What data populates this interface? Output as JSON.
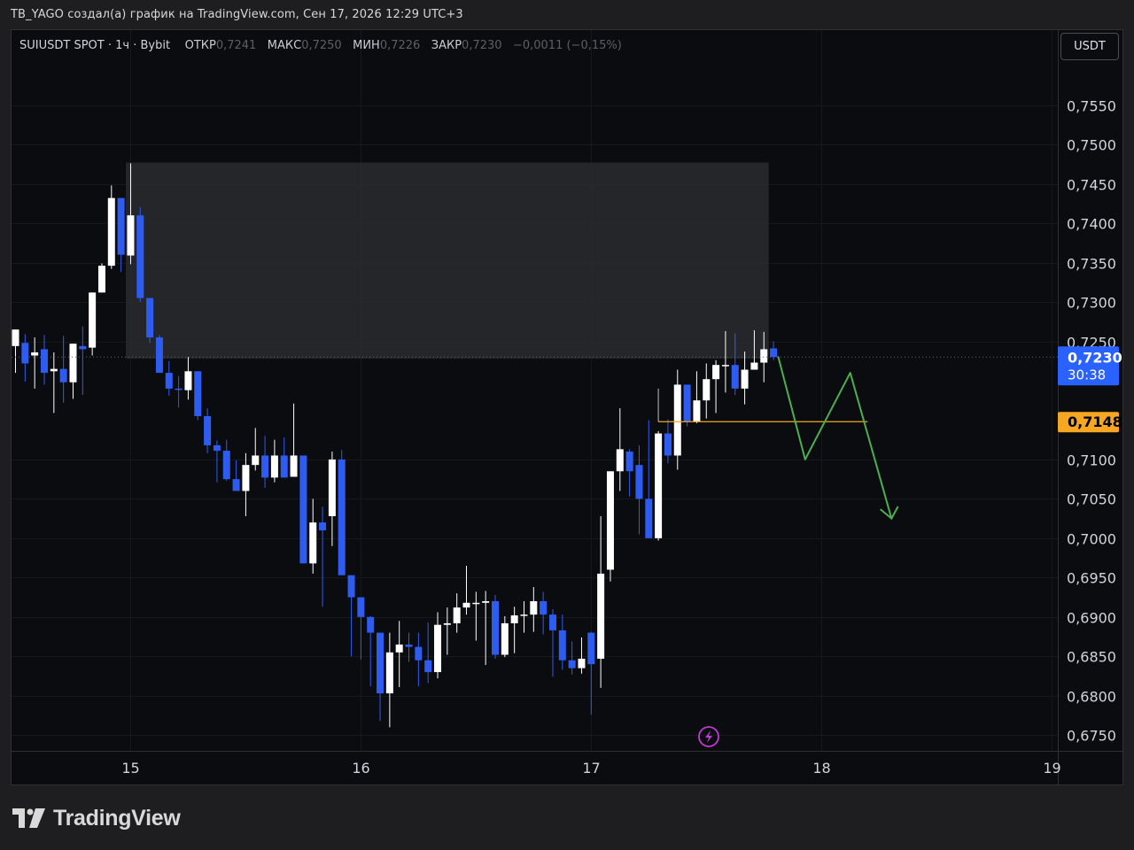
{
  "credit": "TB_YAGO создал(а) график на TradingView.com, Сен 17, 2026 12:29 UTC+3",
  "legend": {
    "symbol": "SUIUSDT SPOT · 1ч · Bybit",
    "open_label": "ОТКР",
    "open_value": "0,7241",
    "high_label": "МАКС",
    "high_value": "0,7250",
    "low_label": "МИН",
    "low_value": "0,7226",
    "close_label": "ЗАКР",
    "close_value": "0,7230",
    "change": "−0,0011 (−0,15%)"
  },
  "currency_button": "USDT",
  "logo_text": "TradingView",
  "colors": {
    "background": "#0b0c10",
    "bull": "#ffffff",
    "bear": "#2f5cf0",
    "zone": "#2a2b2f",
    "level": "#f5a623",
    "projection": "#4caf50",
    "price_tag": "#2962ff",
    "alert_icon": "#c03ad6"
  },
  "price_tag": {
    "price": "0,7230",
    "countdown": "30:38"
  },
  "level_tag": {
    "price": "0,7148"
  },
  "chart_data": {
    "type": "candlestick",
    "interval": "1h",
    "ylim": [
      0.673,
      0.7598
    ],
    "y_ticks": [
      {
        "value": 0.755,
        "label": "0,7550"
      },
      {
        "value": 0.75,
        "label": "0,7500"
      },
      {
        "value": 0.745,
        "label": "0,7450"
      },
      {
        "value": 0.74,
        "label": "0,7400"
      },
      {
        "value": 0.735,
        "label": "0,7350"
      },
      {
        "value": 0.73,
        "label": "0,7300"
      },
      {
        "value": 0.725,
        "label": "0,7250"
      },
      {
        "value": 0.71,
        "label": "0,7100"
      },
      {
        "value": 0.705,
        "label": "0,7050"
      },
      {
        "value": 0.7,
        "label": "0,7000"
      },
      {
        "value": 0.695,
        "label": "0,6950"
      },
      {
        "value": 0.69,
        "label": "0,6900"
      },
      {
        "value": 0.685,
        "label": "0,6850"
      },
      {
        "value": 0.68,
        "label": "0,6800"
      },
      {
        "value": 0.675,
        "label": "0,6750"
      }
    ],
    "x_ticks": [
      {
        "bar": 12,
        "label": "15"
      },
      {
        "bar": 36,
        "label": "16"
      },
      {
        "bar": 60,
        "label": "17"
      },
      {
        "bar": 84,
        "label": "18"
      },
      {
        "bar": 108,
        "label": "19"
      }
    ],
    "candles": [
      {
        "o": 0.7244,
        "h": 0.7263,
        "l": 0.721,
        "c": 0.7265
      },
      {
        "o": 0.7248,
        "h": 0.7259,
        "l": 0.7199,
        "c": 0.7222
      },
      {
        "o": 0.7232,
        "h": 0.7255,
        "l": 0.719,
        "c": 0.7236
      },
      {
        "o": 0.724,
        "h": 0.7258,
        "l": 0.7195,
        "c": 0.721
      },
      {
        "o": 0.7212,
        "h": 0.7236,
        "l": 0.7159,
        "c": 0.7215
      },
      {
        "o": 0.7215,
        "h": 0.7257,
        "l": 0.7172,
        "c": 0.7198
      },
      {
        "o": 0.7198,
        "h": 0.7239,
        "l": 0.7177,
        "c": 0.7247
      },
      {
        "o": 0.7244,
        "h": 0.7269,
        "l": 0.7182,
        "c": 0.724
      },
      {
        "o": 0.7242,
        "h": 0.7282,
        "l": 0.7232,
        "c": 0.7312
      },
      {
        "o": 0.7312,
        "h": 0.7349,
        "l": 0.7312,
        "c": 0.7346
      },
      {
        "o": 0.7346,
        "h": 0.7448,
        "l": 0.7342,
        "c": 0.7432
      },
      {
        "o": 0.7432,
        "h": 0.7432,
        "l": 0.7338,
        "c": 0.736
      },
      {
        "o": 0.7359,
        "h": 0.7476,
        "l": 0.7348,
        "c": 0.741
      },
      {
        "o": 0.741,
        "h": 0.742,
        "l": 0.73,
        "c": 0.7305
      },
      {
        "o": 0.7305,
        "h": 0.73,
        "l": 0.7248,
        "c": 0.7255
      },
      {
        "o": 0.7255,
        "h": 0.7258,
        "l": 0.721,
        "c": 0.721
      },
      {
        "o": 0.721,
        "h": 0.7225,
        "l": 0.7181,
        "c": 0.719
      },
      {
        "o": 0.719,
        "h": 0.7206,
        "l": 0.7166,
        "c": 0.7189
      },
      {
        "o": 0.7188,
        "h": 0.723,
        "l": 0.7176,
        "c": 0.7212
      },
      {
        "o": 0.7212,
        "h": 0.7208,
        "l": 0.715,
        "c": 0.7155
      },
      {
        "o": 0.7155,
        "h": 0.7165,
        "l": 0.7108,
        "c": 0.7118
      },
      {
        "o": 0.7118,
        "h": 0.7124,
        "l": 0.7071,
        "c": 0.7111
      },
      {
        "o": 0.7111,
        "h": 0.7125,
        "l": 0.7073,
        "c": 0.7075
      },
      {
        "o": 0.7075,
        "h": 0.7099,
        "l": 0.7066,
        "c": 0.706
      },
      {
        "o": 0.706,
        "h": 0.7108,
        "l": 0.7028,
        "c": 0.7093
      },
      {
        "o": 0.7093,
        "h": 0.714,
        "l": 0.7086,
        "c": 0.7105
      },
      {
        "o": 0.7105,
        "h": 0.713,
        "l": 0.7064,
        "c": 0.7077
      },
      {
        "o": 0.7077,
        "h": 0.7125,
        "l": 0.7071,
        "c": 0.7105
      },
      {
        "o": 0.7105,
        "h": 0.7128,
        "l": 0.7084,
        "c": 0.7077
      },
      {
        "o": 0.7078,
        "h": 0.7171,
        "l": 0.7082,
        "c": 0.7105
      },
      {
        "o": 0.7105,
        "h": 0.7094,
        "l": 0.6978,
        "c": 0.6968
      },
      {
        "o": 0.6968,
        "h": 0.705,
        "l": 0.6955,
        "c": 0.702
      },
      {
        "o": 0.702,
        "h": 0.704,
        "l": 0.6913,
        "c": 0.701
      },
      {
        "o": 0.7028,
        "h": 0.711,
        "l": 0.699,
        "c": 0.71
      },
      {
        "o": 0.71,
        "h": 0.7112,
        "l": 0.6974,
        "c": 0.6953
      },
      {
        "o": 0.6953,
        "h": 0.6949,
        "l": 0.685,
        "c": 0.6925
      },
      {
        "o": 0.6925,
        "h": 0.692,
        "l": 0.6846,
        "c": 0.69
      },
      {
        "o": 0.69,
        "h": 0.6901,
        "l": 0.6812,
        "c": 0.688
      },
      {
        "o": 0.688,
        "h": 0.6876,
        "l": 0.6768,
        "c": 0.6803
      },
      {
        "o": 0.6803,
        "h": 0.688,
        "l": 0.676,
        "c": 0.6855
      },
      {
        "o": 0.6855,
        "h": 0.6895,
        "l": 0.6811,
        "c": 0.6865
      },
      {
        "o": 0.6865,
        "h": 0.688,
        "l": 0.6843,
        "c": 0.6862
      },
      {
        "o": 0.6862,
        "h": 0.688,
        "l": 0.6812,
        "c": 0.6845
      },
      {
        "o": 0.6845,
        "h": 0.6893,
        "l": 0.6816,
        "c": 0.683
      },
      {
        "o": 0.683,
        "h": 0.6906,
        "l": 0.6822,
        "c": 0.689
      },
      {
        "o": 0.689,
        "h": 0.6912,
        "l": 0.6852,
        "c": 0.6892
      },
      {
        "o": 0.6892,
        "h": 0.693,
        "l": 0.688,
        "c": 0.6912
      },
      {
        "o": 0.6912,
        "h": 0.6965,
        "l": 0.6903,
        "c": 0.6918
      },
      {
        "o": 0.6918,
        "h": 0.6932,
        "l": 0.687,
        "c": 0.6918
      },
      {
        "o": 0.6918,
        "h": 0.6933,
        "l": 0.6839,
        "c": 0.692
      },
      {
        "o": 0.692,
        "h": 0.6928,
        "l": 0.6847,
        "c": 0.6852
      },
      {
        "o": 0.6852,
        "h": 0.6901,
        "l": 0.6849,
        "c": 0.6892
      },
      {
        "o": 0.6892,
        "h": 0.6913,
        "l": 0.6854,
        "c": 0.6902
      },
      {
        "o": 0.6902,
        "h": 0.692,
        "l": 0.688,
        "c": 0.6903
      },
      {
        "o": 0.6903,
        "h": 0.6938,
        "l": 0.6881,
        "c": 0.692
      },
      {
        "o": 0.692,
        "h": 0.6932,
        "l": 0.6878,
        "c": 0.6903
      },
      {
        "o": 0.6903,
        "h": 0.691,
        "l": 0.6824,
        "c": 0.6883
      },
      {
        "o": 0.6883,
        "h": 0.6903,
        "l": 0.6833,
        "c": 0.6845
      },
      {
        "o": 0.6845,
        "h": 0.6869,
        "l": 0.6827,
        "c": 0.6835
      },
      {
        "o": 0.6835,
        "h": 0.6874,
        "l": 0.6828,
        "c": 0.6847
      },
      {
        "o": 0.688,
        "h": 0.6881,
        "l": 0.6776,
        "c": 0.684
      },
      {
        "o": 0.6847,
        "h": 0.7028,
        "l": 0.681,
        "c": 0.6955
      },
      {
        "o": 0.696,
        "h": 0.7085,
        "l": 0.6945,
        "c": 0.7085
      },
      {
        "o": 0.7085,
        "h": 0.7165,
        "l": 0.706,
        "c": 0.7113
      },
      {
        "o": 0.711,
        "h": 0.7113,
        "l": 0.7053,
        "c": 0.7085
      },
      {
        "o": 0.7093,
        "h": 0.7118,
        "l": 0.7005,
        "c": 0.705
      },
      {
        "o": 0.705,
        "h": 0.715,
        "l": 0.7013,
        "c": 0.7
      },
      {
        "o": 0.7,
        "h": 0.7136,
        "l": 0.6997,
        "c": 0.7133
      },
      {
        "o": 0.7133,
        "h": 0.7151,
        "l": 0.7095,
        "c": 0.7105
      },
      {
        "o": 0.7105,
        "h": 0.7214,
        "l": 0.7087,
        "c": 0.7195
      },
      {
        "o": 0.7195,
        "h": 0.7186,
        "l": 0.7142,
        "c": 0.7148
      },
      {
        "o": 0.7148,
        "h": 0.7212,
        "l": 0.7146,
        "c": 0.7175
      },
      {
        "o": 0.7175,
        "h": 0.7222,
        "l": 0.7152,
        "c": 0.7202
      },
      {
        "o": 0.7202,
        "h": 0.7226,
        "l": 0.7159,
        "c": 0.722
      },
      {
        "o": 0.722,
        "h": 0.7263,
        "l": 0.7185,
        "c": 0.722
      },
      {
        "o": 0.722,
        "h": 0.726,
        "l": 0.7182,
        "c": 0.719
      },
      {
        "o": 0.719,
        "h": 0.7237,
        "l": 0.717,
        "c": 0.7214
      },
      {
        "o": 0.7214,
        "h": 0.7264,
        "l": 0.7218,
        "c": 0.7223
      },
      {
        "o": 0.7223,
        "h": 0.7262,
        "l": 0.7198,
        "c": 0.724
      },
      {
        "o": 0.7241,
        "h": 0.725,
        "l": 0.7226,
        "c": 0.723
      }
    ],
    "annotations": {
      "zone": {
        "bar_start": 11.5,
        "bar_end": 78.5,
        "price_top": 0.7477,
        "price_bottom": 0.7228
      },
      "level": {
        "bar_start": 67,
        "bar_end": 88.8,
        "price": 0.7148
      },
      "projection_path": [
        {
          "bar": 79.5,
          "price": 0.723
        },
        {
          "bar": 82.3,
          "price": 0.71
        },
        {
          "bar": 87.0,
          "price": 0.721
        },
        {
          "bar": 91.3,
          "price": 0.7025
        }
      ]
    }
  }
}
